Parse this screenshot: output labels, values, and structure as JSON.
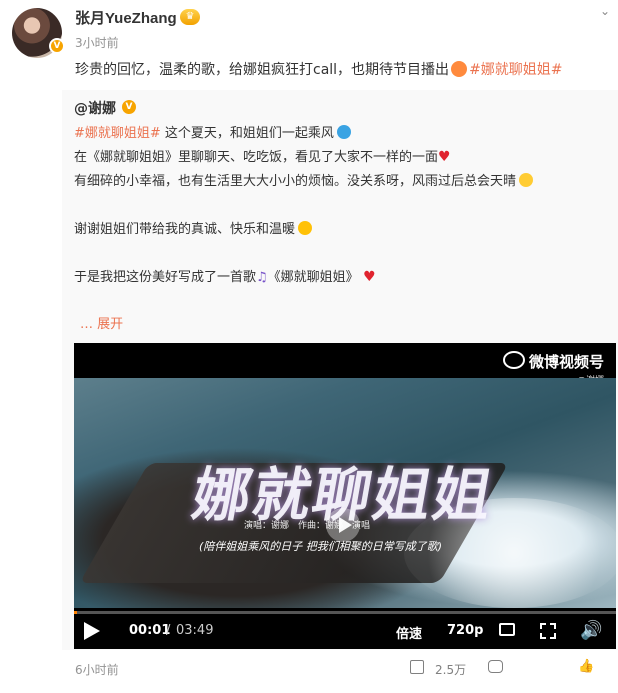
{
  "post": {
    "author": "张月YueZhang",
    "time": "3小时前",
    "text_main": "珍贵的回忆，温柔的歌，给娜姐疯狂打call，也期待节目播出",
    "topic": "#娜就聊姐姐#"
  },
  "repost": {
    "author": "@谢娜",
    "line1_topic": "#娜就聊姐姐#",
    "line1_text": " 这个夏天，和姐姐们一起乘风",
    "line2_text": "在《娜就聊姐姐》里聊聊天、吃吃饭，看见了大家不一样的一面",
    "line3_text": "有细碎的小幸福，也有生活里大大小小的烦恼。没关系呀，风雨过后总会天晴",
    "line4_text": "谢谢姐姐们带给我的真诚、快乐和温暖",
    "line5_text": "于是我把这份美好写成了一首歌",
    "line5_song": "《娜就聊姐姐》",
    "expand": "展开"
  },
  "video": {
    "watermark": "微博视频号",
    "watermark_sub": "@谢娜",
    "title_overlay": "娜就聊姐姐",
    "credits": "演唱：谢娜　作曲：谢娜　演唱",
    "caption": "(陪伴姐姐乘风的日子 把我们相聚的日常写成了歌)",
    "time_current": "00:01",
    "time_separator": "/",
    "time_total": "03:49",
    "speed_label": "倍速",
    "quality_label": "720p",
    "progress_fraction": 0.005
  },
  "footer": {
    "time": "6小时前",
    "share_count": "2.5万",
    "comment_count": "",
    "like_count": ""
  },
  "icons": {
    "vip": "crown-badge",
    "verify": "v-badge",
    "more": "chevron-down-icon"
  },
  "colors": {
    "topic": "#eb7350",
    "accent": "#ff8200"
  }
}
